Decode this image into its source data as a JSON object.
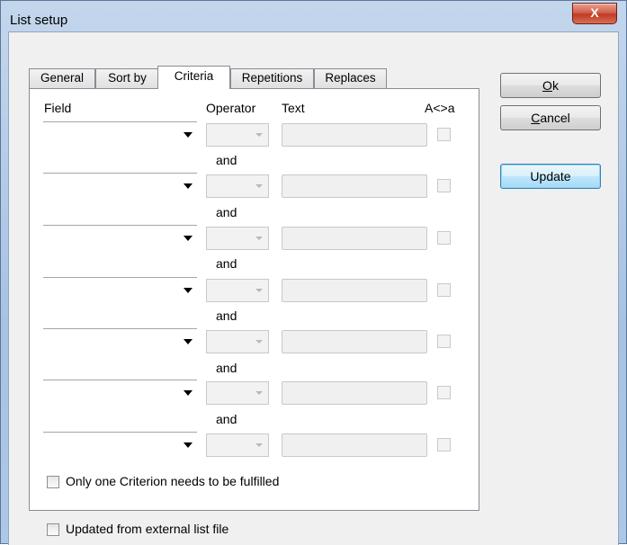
{
  "window": {
    "title": "List setup",
    "close_glyph": "X"
  },
  "tabs": [
    "General",
    "Sort by",
    "Criteria",
    "Repetitions",
    "Replaces"
  ],
  "active_tab": "Criteria",
  "columns": {
    "field": "Field",
    "operator": "Operator",
    "text": "Text",
    "case": "A<>a"
  },
  "connector": "and",
  "criteria_rows": [
    {
      "field": "",
      "operator": "",
      "text": "",
      "case_checked": false
    },
    {
      "field": "",
      "operator": "",
      "text": "",
      "case_checked": false
    },
    {
      "field": "",
      "operator": "",
      "text": "",
      "case_checked": false
    },
    {
      "field": "",
      "operator": "",
      "text": "",
      "case_checked": false
    },
    {
      "field": "",
      "operator": "",
      "text": "",
      "case_checked": false
    },
    {
      "field": "",
      "operator": "",
      "text": "",
      "case_checked": false
    },
    {
      "field": "",
      "operator": "",
      "text": "",
      "case_checked": false
    }
  ],
  "only_one_criterion": {
    "label": "Only one Criterion needs to be fulfilled",
    "checked": false
  },
  "external_list": {
    "label": "Updated from external list file",
    "checked": false
  },
  "buttons": {
    "ok": {
      "mnemonic": "O",
      "rest": "k"
    },
    "cancel": {
      "mnemonic": "C",
      "rest": "ancel"
    },
    "update": "Update"
  }
}
